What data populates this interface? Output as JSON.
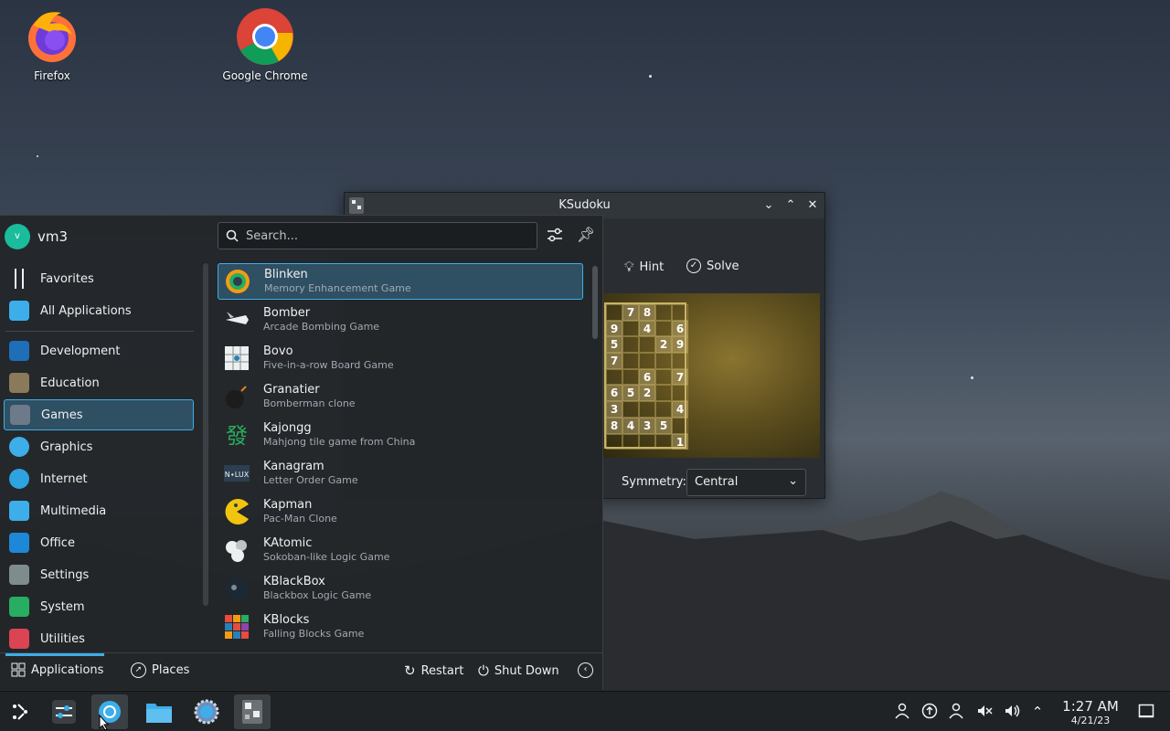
{
  "desktop": {
    "icons": [
      {
        "label": "Firefox"
      },
      {
        "label": "Google Chrome"
      }
    ]
  },
  "ksudoku": {
    "title": "KSudoku",
    "toolbar": {
      "hint": "Hint",
      "solve": "Solve"
    },
    "grid_visible": [
      [
        "",
        "7",
        "8",
        "",
        ""
      ],
      [
        "9",
        "",
        "4",
        "",
        "6"
      ],
      [
        "5",
        "",
        "",
        "2",
        "9"
      ],
      [
        "7",
        "",
        "",
        "",
        ""
      ],
      [
        "",
        "",
        "6",
        "",
        "7"
      ],
      [
        "6",
        "5",
        "2",
        "",
        ""
      ],
      [
        "3",
        "",
        "",
        "",
        "4"
      ],
      [
        "8",
        "4",
        "3",
        "5",
        ""
      ],
      [
        "",
        "",
        "",
        "",
        "1"
      ]
    ],
    "symmetry_label": "Symmetry:",
    "symmetry_value": "Central"
  },
  "launcher": {
    "user": {
      "name": "vm3",
      "initial": "v"
    },
    "search_placeholder": "Search...",
    "categories": [
      {
        "label": "Favorites",
        "icon": "bookmark-icon"
      },
      {
        "label": "All Applications",
        "icon": "grid-icon"
      },
      {
        "label": "Development",
        "icon": "development-icon"
      },
      {
        "label": "Education",
        "icon": "education-icon"
      },
      {
        "label": "Games",
        "icon": "gamepad-icon",
        "selected": true
      },
      {
        "label": "Graphics",
        "icon": "graphics-icon"
      },
      {
        "label": "Internet",
        "icon": "internet-icon"
      },
      {
        "label": "Multimedia",
        "icon": "multimedia-icon"
      },
      {
        "label": "Office",
        "icon": "office-icon"
      },
      {
        "label": "Settings",
        "icon": "settings-icon"
      },
      {
        "label": "System",
        "icon": "system-icon"
      },
      {
        "label": "Utilities",
        "icon": "utilities-icon"
      }
    ],
    "apps": [
      {
        "name": "Blinken",
        "desc": "Memory Enhancement Game",
        "selected": true
      },
      {
        "name": "Bomber",
        "desc": "Arcade Bombing Game"
      },
      {
        "name": "Bovo",
        "desc": "Five-in-a-row Board Game"
      },
      {
        "name": "Granatier",
        "desc": "Bomberman clone"
      },
      {
        "name": "Kajongg",
        "desc": "Mahjong tile game from China"
      },
      {
        "name": "Kanagram",
        "desc": "Letter Order Game"
      },
      {
        "name": "Kapman",
        "desc": "Pac-Man Clone"
      },
      {
        "name": "KAtomic",
        "desc": "Sokoban-like Logic Game"
      },
      {
        "name": "KBlackBox",
        "desc": "Blackbox Logic Game"
      },
      {
        "name": "KBlocks",
        "desc": "Falling Blocks Game"
      }
    ],
    "footer": {
      "applications": "Applications",
      "places": "Places",
      "restart": "Restart",
      "shutdown": "Shut Down"
    }
  },
  "taskbar": {
    "time": "1:27 AM",
    "date": "4/21/23"
  },
  "colors": {
    "accent": "#3daee9",
    "panel": "#232629",
    "taskbar": "#202326"
  }
}
